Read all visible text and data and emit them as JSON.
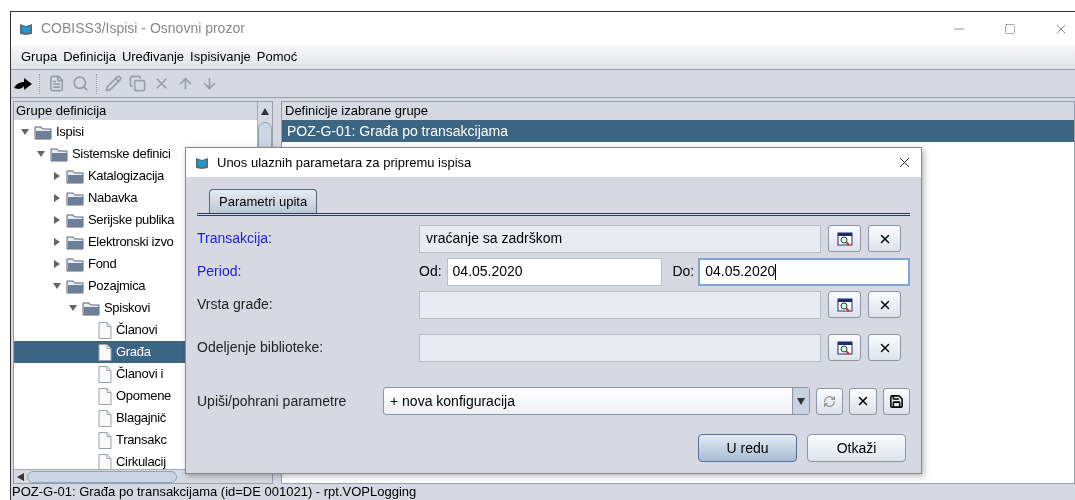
{
  "window": {
    "title": "COBISS3/Ispisi - Osnovni prozor"
  },
  "menu": [
    "Grupa",
    "Definicija",
    "Uređivanje",
    "Ispisivanje",
    "Pomoć"
  ],
  "toolbar": [
    {
      "kind": "exit",
      "disabled": false
    },
    {
      "kind": "new",
      "disabled": true
    },
    {
      "kind": "search",
      "disabled": true
    },
    {
      "kind": "edit",
      "disabled": true
    },
    {
      "kind": "copy",
      "disabled": true
    },
    {
      "kind": "delete",
      "disabled": true
    },
    {
      "kind": "up",
      "disabled": true
    },
    {
      "kind": "down",
      "disabled": true
    }
  ],
  "tree": {
    "title": "Grupe definicija",
    "items": [
      {
        "label": "Ispisi",
        "kind": "folder",
        "expanded": true,
        "selected": false,
        "children": [
          {
            "label": "Sistemske definici",
            "kind": "folder",
            "expanded": true,
            "selected": false,
            "children": [
              {
                "label": "Katalogizacija",
                "kind": "folder",
                "expanded": false,
                "selected": false
              },
              {
                "label": "Nabavka",
                "kind": "folder",
                "expanded": false,
                "selected": false
              },
              {
                "label": "Serijske publika",
                "kind": "folder",
                "expanded": false,
                "selected": false
              },
              {
                "label": "Elektronski izvo",
                "kind": "folder",
                "expanded": false,
                "selected": false
              },
              {
                "label": "Fond",
                "kind": "folder",
                "expanded": false,
                "selected": false
              },
              {
                "label": "Pozajmica",
                "kind": "folder",
                "expanded": true,
                "selected": false,
                "children": [
                  {
                    "label": "Spiskovi",
                    "kind": "folder",
                    "expanded": true,
                    "selected": false,
                    "children": [
                      {
                        "label": "Članovi",
                        "kind": "doc",
                        "selected": false
                      },
                      {
                        "label": "Građa",
                        "kind": "doc",
                        "selected": true
                      },
                      {
                        "label": "Članovi i",
                        "kind": "doc",
                        "selected": false
                      },
                      {
                        "label": "Opomene",
                        "kind": "doc",
                        "selected": false
                      },
                      {
                        "label": "Blagajnič",
                        "kind": "doc",
                        "selected": false
                      },
                      {
                        "label": "Transakc",
                        "kind": "doc",
                        "selected": false
                      },
                      {
                        "label": "Cirkulacij",
                        "kind": "doc",
                        "selected": false
                      }
                    ]
                  }
                ]
              }
            ]
          }
        ]
      }
    ]
  },
  "definitions": {
    "title": "Definicije izabrane grupe",
    "items": [
      {
        "label": "POZ-G-01: Građa po transakcijama",
        "selected": true
      }
    ]
  },
  "dialog": {
    "title": "Unos ulaznih parametara za pripremu ispisa",
    "tabs": [
      {
        "label": "Parametri upita",
        "selected": true
      }
    ],
    "fields": [
      {
        "kind": "lookup",
        "label": "Transakcija:",
        "required": true,
        "value": "vraćanje sa zadrškom"
      },
      {
        "kind": "period",
        "label": "Period:",
        "required": true,
        "from_label": "Od:",
        "from": "04.05.2020",
        "to_label": "Do:",
        "to": "04.05.2020",
        "to_focused": true
      },
      {
        "kind": "lookup",
        "label": "Vrsta građe:",
        "required": false
      },
      {
        "kind": "lookup",
        "label": "Odeljenje biblioteke:",
        "required": false
      }
    ],
    "config": {
      "label": "Upiši/pohrani parametre",
      "value": "+ nova konfiguracija"
    },
    "buttons": [
      {
        "label": "U redu",
        "default": true
      },
      {
        "label": "Otkaži",
        "default": false
      }
    ]
  },
  "status_bar": "POZ-G-01: Građa po transakcijama (id=DE  001021) - rpt.VOPLogging"
}
